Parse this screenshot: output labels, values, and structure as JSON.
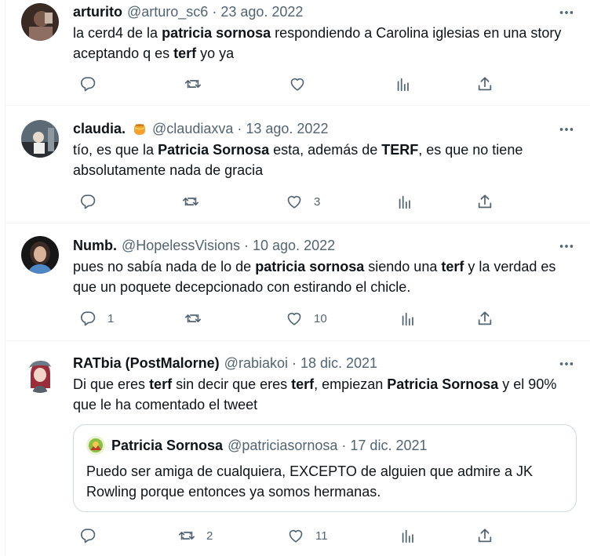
{
  "tweets": [
    {
      "name": "arturito",
      "handle": "@arturo_sc6",
      "separator": "·",
      "date": "23 ago. 2022",
      "text": [
        {
          "t": "la cerd4 de la "
        },
        {
          "t": "patricia sornosa",
          "b": true
        },
        {
          "t": " respondiendo a Carolina iglesias en una story aceptando q es "
        },
        {
          "t": "terf",
          "b": true
        },
        {
          "t": " yo ya"
        }
      ],
      "replies": "",
      "retweets": "",
      "likes": ""
    },
    {
      "name": "claudia.",
      "badge": "honey-pot-emoji",
      "handle": "@claudiaxva",
      "separator": "·",
      "date": "13 ago. 2022",
      "text": [
        {
          "t": "tío, es que la "
        },
        {
          "t": "Patricia Sornosa",
          "b": true
        },
        {
          "t": " esta, además de "
        },
        {
          "t": "TERF",
          "b": true
        },
        {
          "t": ", es que no tiene absolutamente nada de gracia"
        }
      ],
      "replies": "",
      "retweets": "",
      "likes": "3"
    },
    {
      "name": "Numb.",
      "handle": "@HopelessVisions",
      "separator": "·",
      "date": "10 ago. 2022",
      "text": [
        {
          "t": "pues no sabía nada de lo de "
        },
        {
          "t": "patricia sornosa",
          "b": true
        },
        {
          "t": " siendo una "
        },
        {
          "t": "terf",
          "b": true
        },
        {
          "t": " y la verdad es que un poquete decepcionado con estirando el chicle."
        }
      ],
      "replies": "1",
      "retweets": "",
      "likes": "10"
    },
    {
      "name": "RATbia (PostMalorne)",
      "handle": "@rabiakoi",
      "separator": "·",
      "date": "18 dic. 2021",
      "text": [
        {
          "t": "Di que eres "
        },
        {
          "t": "terf",
          "b": true
        },
        {
          "t": " sin decir que eres "
        },
        {
          "t": "terf",
          "b": true
        },
        {
          "t": ", empiezan "
        },
        {
          "t": "Patricia Sornosa",
          "b": true
        },
        {
          "t": " y el 90% que le ha comentado el tweet"
        }
      ],
      "quote": {
        "name": "Patricia Sornosa",
        "handle": "@patriciasornosa",
        "separator": "·",
        "date": "17 dic. 2021",
        "text": "Puedo ser amiga de cualquiera, EXCEPTO de alguien que admire a JK Rowling porque entonces ya somos hermanas."
      },
      "replies": "",
      "retweets": "2",
      "likes": "11"
    }
  ],
  "icons": {
    "reply": "speech-bubble-icon",
    "retweet": "retweet-arrows-icon",
    "like": "heart-icon",
    "views": "bar-chart-icon",
    "share": "share-upload-icon",
    "more": "three-dots-icon"
  },
  "colors": {
    "text": "#0f1419",
    "secondary": "#536471",
    "border": "#eff3f4",
    "quote_border": "#cfd9de"
  }
}
